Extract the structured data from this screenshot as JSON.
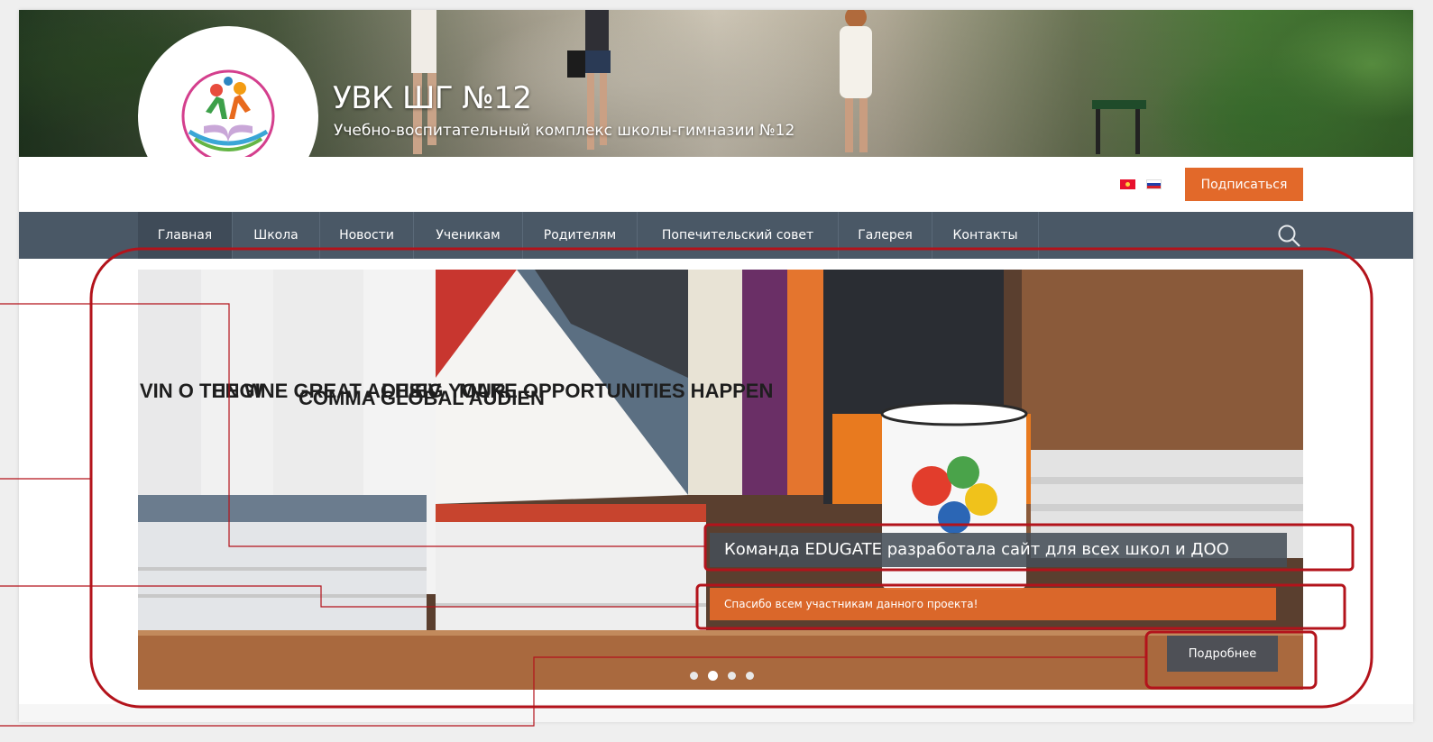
{
  "header": {
    "site_title": "УВК ШГ №12",
    "site_subtitle": "Учебно-воспитательный комплекс школы-гимназии №12",
    "logo_icon": "school-logo-icon"
  },
  "topbar": {
    "languages": [
      {
        "code": "kg",
        "icon": "flag-kyrgyzstan-icon"
      },
      {
        "code": "ru",
        "icon": "flag-russia-icon"
      }
    ],
    "subscribe_label": "Подписаться"
  },
  "nav": {
    "items": [
      {
        "label": "Главная",
        "active": true
      },
      {
        "label": "Школа",
        "active": false
      },
      {
        "label": "Новости",
        "active": false
      },
      {
        "label": "Ученикам",
        "active": false
      },
      {
        "label": "Родителям",
        "active": false
      },
      {
        "label": "Попечительский совет",
        "active": false
      },
      {
        "label": "Галерея",
        "active": false
      },
      {
        "label": "Контакты",
        "active": false
      }
    ],
    "search_icon": "search-icon"
  },
  "slider": {
    "caption_title": "Команда EDUGATE разработала сайт для всех школ и ДОО",
    "caption_subtitle": "Спасибо всем участникам данного проекта!",
    "more_label": "Подробнее",
    "dots_count": 4,
    "active_dot": 2,
    "brochures": [
      "VIN O THE W",
      "ENGINE GREAT ACHIEV",
      "COMMA GLOBAL AUDIEN",
      "DESIG YOUR",
      "MAKE OPPORTUNITIES HAPPEN"
    ]
  },
  "colors": {
    "accent_orange": "#e2692a",
    "nav_bg": "#4a5866",
    "annotation_red": "#b3131b"
  }
}
